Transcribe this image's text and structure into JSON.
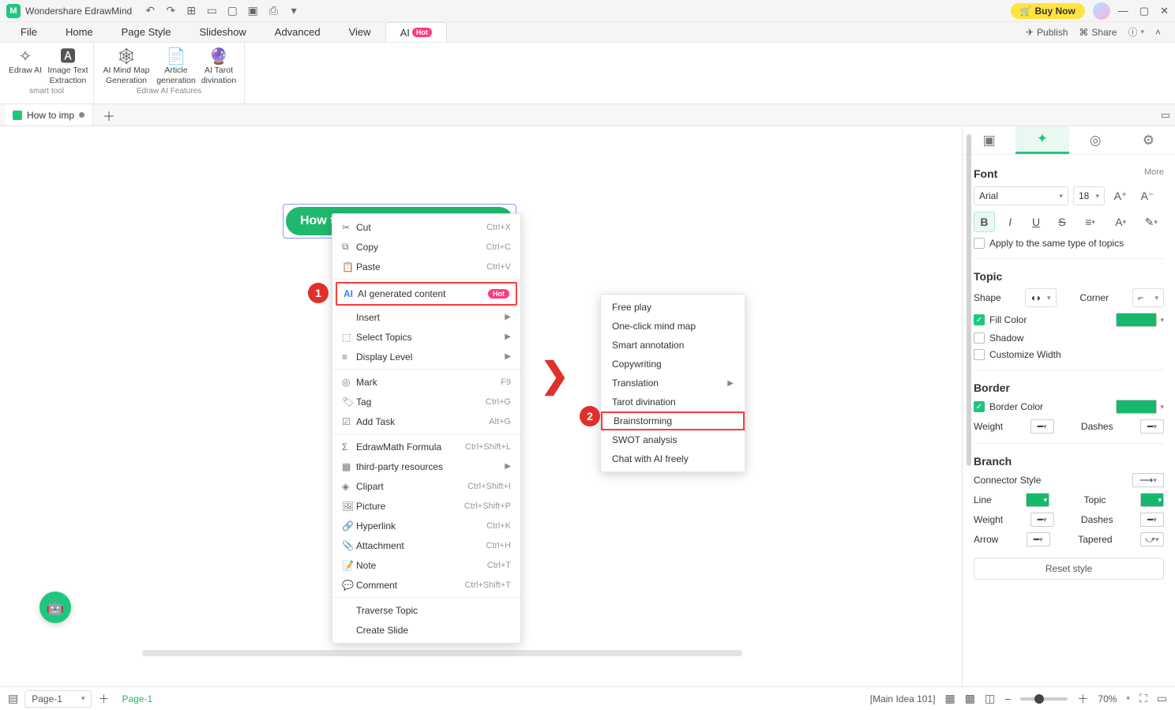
{
  "app": {
    "title": "Wondershare EdrawMind",
    "buy": "Buy Now"
  },
  "menu": {
    "file": "File",
    "home": "Home",
    "page_style": "Page Style",
    "slideshow": "Slideshow",
    "advanced": "Advanced",
    "view": "View",
    "ai": "AI",
    "ai_badge": "Hot",
    "publish": "Publish",
    "share": "Share"
  },
  "ribbon": {
    "edraw_ai": "Edraw AI",
    "img_text": "Image Text Extraction",
    "smart_tool": "smart tool",
    "mindmap_gen": "AI Mind Map Generation",
    "article_gen": "Article generation",
    "tarot": "AI Tarot divination",
    "features": "Edraw AI Features"
  },
  "doctab": {
    "name": "How to imp"
  },
  "node": {
    "text": "How t"
  },
  "ctx": {
    "cut": "Cut",
    "cut_s": "Ctrl+X",
    "copy": "Copy",
    "copy_s": "Ctrl+C",
    "paste": "Paste",
    "paste_s": "Ctrl+V",
    "ai_gen": "AI generated content",
    "ai_badge": "Hot",
    "insert": "Insert",
    "select_topics": "Select Topics",
    "display_level": "Display Level",
    "mark": "Mark",
    "mark_s": "F9",
    "tag": "Tag",
    "tag_s": "Ctrl+G",
    "add_task": "Add Task",
    "add_task_s": "Alt+G",
    "formula": "EdrawMath Formula",
    "formula_s": "Ctrl+Shift+L",
    "third_party": "third-party resources",
    "clipart": "Clipart",
    "clipart_s": "Ctrl+Shift+I",
    "picture": "Picture",
    "picture_s": "Ctrl+Shift+P",
    "hyperlink": "Hyperlink",
    "hyperlink_s": "Ctrl+K",
    "attachment": "Attachment",
    "attachment_s": "Ctrl+H",
    "note": "Note",
    "note_s": "Ctrl+T",
    "comment": "Comment",
    "comment_s": "Ctrl+Shift+T",
    "traverse": "Traverse Topic",
    "create_slide": "Create Slide"
  },
  "sub": {
    "free_play": "Free play",
    "one_click": "One-click mind map",
    "smart_anno": "Smart annotation",
    "copywriting": "Copywriting",
    "translation": "Translation",
    "tarot": "Tarot divination",
    "brainstorm": "Brainstorming",
    "swot": "SWOT analysis",
    "chat": "Chat with AI freely"
  },
  "badge": {
    "one": "1",
    "two": "2"
  },
  "panel": {
    "font": "Font",
    "more": "More",
    "font_name": "Arial",
    "font_size": "18",
    "apply_same": "Apply to the same type of topics",
    "topic": "Topic",
    "shape": "Shape",
    "corner": "Corner",
    "fill_color": "Fill Color",
    "shadow": "Shadow",
    "custom_width": "Customize Width",
    "border": "Border",
    "border_color": "Border Color",
    "weight": "Weight",
    "dashes": "Dashes",
    "branch": "Branch",
    "connector": "Connector Style",
    "line": "Line",
    "topic_color": "Topic",
    "arrow": "Arrow",
    "tapered": "Tapered",
    "reset": "Reset style"
  },
  "status": {
    "page_sel": "Page-1",
    "page_tab": "Page-1",
    "main_idea": "[Main Idea 101]",
    "zoom": "70%"
  }
}
